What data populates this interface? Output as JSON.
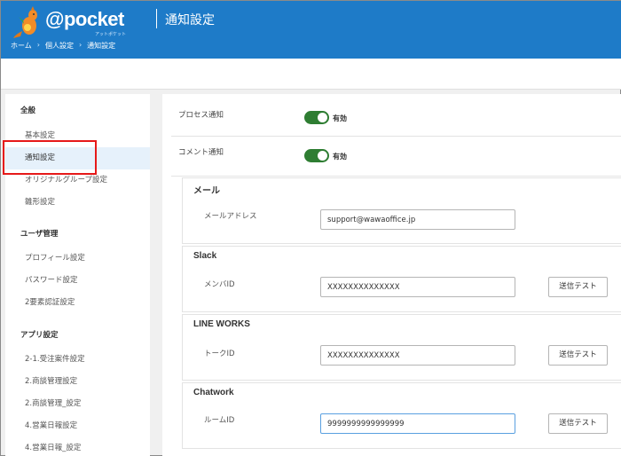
{
  "header": {
    "logo_text": "@pocket",
    "logo_sub": "アットポケット",
    "page_title": "通知設定",
    "breadcrumb": [
      "ホーム",
      "個人設定",
      "通知設定"
    ],
    "brand_color": "#1e7bc8"
  },
  "sidebar": {
    "sections": [
      {
        "heading": "全般",
        "items": [
          "基本設定",
          "通知設定",
          "オリジナルグループ設定",
          "雛形設定"
        ]
      },
      {
        "heading": "ユーザ管理",
        "items": [
          "プロフィール設定",
          "パスワード設定",
          "2要素認証設定"
        ]
      },
      {
        "heading": "アプリ設定",
        "items": [
          "2-1.受注案件設定",
          "2.商談管理設定",
          "2.商談管理_設定",
          "4.営業日報設定",
          "4.営業日報_設定"
        ]
      }
    ],
    "active_item": "通知設定"
  },
  "notifications": {
    "process": {
      "label": "プロセス通知",
      "status": "有効",
      "enabled": true
    },
    "comment": {
      "label": "コメント通知",
      "status": "有効",
      "enabled": true
    }
  },
  "mail": {
    "title": "メール",
    "field_label": "メールアドレス",
    "value": "support@wawaoffice.jp"
  },
  "slack": {
    "title": "Slack",
    "field_label": "メンバID",
    "value": "XXXXXXXXXXXXXX",
    "button": "送信テスト"
  },
  "lineworks": {
    "title": "LINE WORKS",
    "field_label": "トークID",
    "value": "XXXXXXXXXXXXXX",
    "button": "送信テスト"
  },
  "chatwork": {
    "title": "Chatwork",
    "field_label": "ルームID",
    "value": "9999999999999999",
    "button": "送信テスト"
  },
  "colors": {
    "toggle_on": "#2e7d32",
    "highlight": "#e61919",
    "active_bg": "#e6f1fb"
  }
}
